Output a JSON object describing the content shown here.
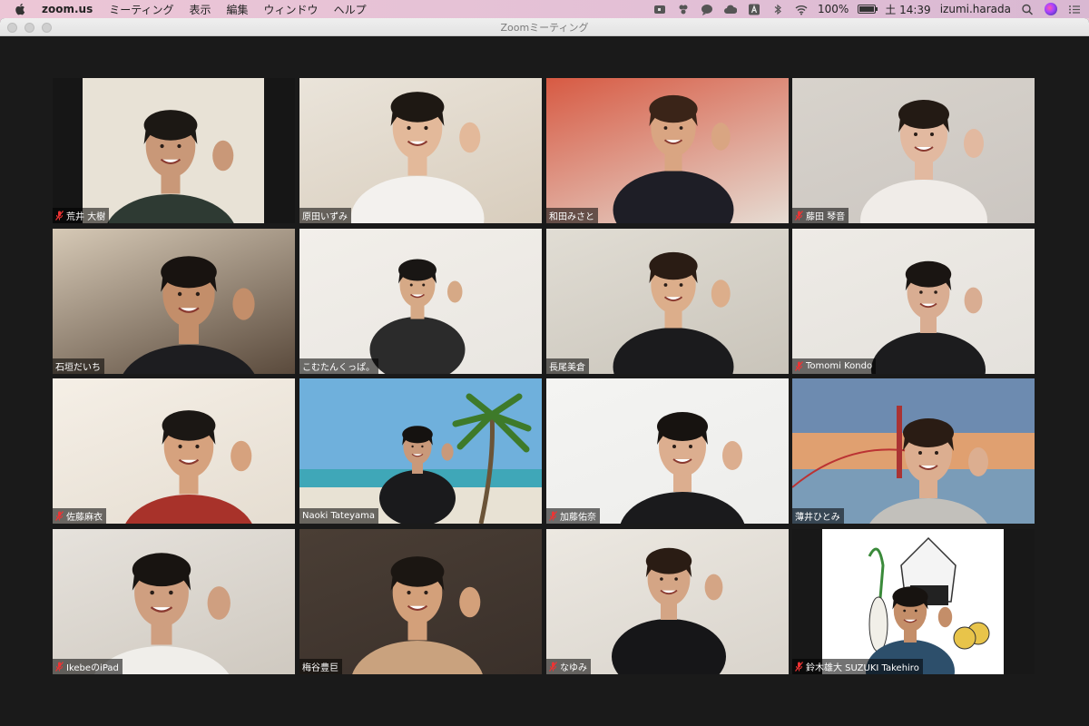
{
  "menubar": {
    "app_name": "zoom.us",
    "menus": [
      "ミーティング",
      "表示",
      "編集",
      "ウィンドウ",
      "ヘルプ"
    ],
    "battery_percent": "100%",
    "battery_level": 1.0,
    "clock": "土 14:39",
    "user": "izumi.harada"
  },
  "window": {
    "title": "Zoomミーティング"
  },
  "participants": [
    {
      "name": "荒井 大樹",
      "muted": true,
      "bg": "#3c3a36",
      "wall": "#e8e2d6",
      "shirt": "#2e3a33",
      "skin": "#c99878",
      "hair": "#1c1814"
    },
    {
      "name": "原田いずみ",
      "muted": false,
      "bg": "#d8cdbd",
      "wall": "#eae4da",
      "shirt": "#f3f1ee",
      "skin": "#e3b99a",
      "hair": "#1e1813"
    },
    {
      "name": "和田みさと",
      "muted": false,
      "bg": "#e6dcd3",
      "wall": "#d75a43",
      "shirt": "#1e1e26",
      "skin": "#d9a582",
      "hair": "#3a2418"
    },
    {
      "name": "藤田 琴音",
      "muted": true,
      "bg": "#cbc6c1",
      "wall": "#d8d3cc",
      "shirt": "#f0ece8",
      "skin": "#e2b9a0",
      "hair": "#231a14"
    },
    {
      "name": "石垣だいち",
      "muted": false,
      "bg": "#5a4a3c",
      "wall": "#d6c9b6",
      "shirt": "#1d1d20",
      "skin": "#c38e6a",
      "hair": "#181310"
    },
    {
      "name": "こむたんくっぱ。",
      "muted": false,
      "bg": "#e9e6e1",
      "wall": "#f2efea",
      "shirt": "#2b2b2b",
      "skin": "#d6a986",
      "hair": "#191614"
    },
    {
      "name": "長尾美倉",
      "muted": false,
      "bg": "#c9c4ba",
      "wall": "#e1ddd4",
      "shirt": "#1b1b1d",
      "skin": "#dcae8b",
      "hair": "#2a1c14"
    },
    {
      "name": "Tomomi Kondo",
      "muted": true,
      "bg": "#e4e1dc",
      "wall": "#eeebe6",
      "shirt": "#1c1c1e",
      "skin": "#d9ad92",
      "hair": "#1a1512"
    },
    {
      "name": "佐藤麻衣",
      "muted": true,
      "bg": "#e5ddd1",
      "wall": "#f5efe6",
      "shirt": "#a8322a",
      "skin": "#d6a27e",
      "hair": "#1b1714"
    },
    {
      "name": "Naoki Tateyama",
      "muted": false,
      "bg": "#6fa3cf",
      "wall": "#7db9e0",
      "shirt": "#1a1a1c",
      "skin": "#c9997a",
      "hair": "#151210"
    },
    {
      "name": "加藤佑奈",
      "muted": true,
      "bg": "#ededeb",
      "wall": "#f4f4f2",
      "shirt": "#1a1a1c",
      "skin": "#dcae8f",
      "hair": "#171310"
    },
    {
      "name": "薄井ひとみ",
      "muted": false,
      "bg": "#b9734d",
      "wall": "#6f8fab",
      "shirt": "#c2c0bb",
      "skin": "#dcae90",
      "hair": "#2a1c14"
    },
    {
      "name": "IkebeのiPad",
      "muted": true,
      "bg": "#cfc9c0",
      "wall": "#e6e2dc",
      "shirt": "#f0eeea",
      "skin": "#cf9f80",
      "hair": "#181411"
    },
    {
      "name": "梅谷豊巨",
      "muted": false,
      "bg": "#3a302a",
      "wall": "#4a3e35",
      "shirt": "#c9a27e",
      "skin": "#d3a07a",
      "hair": "#1b1612"
    },
    {
      "name": "なゆみ",
      "muted": true,
      "bg": "#d9d4cc",
      "wall": "#ece8e1",
      "shirt": "#161618",
      "skin": "#d4a585",
      "hair": "#2a1c14"
    },
    {
      "name": "鈴木雄大 SUZUKI Takehiro",
      "muted": true,
      "bg": "#ffffff",
      "wall": "#ffffff",
      "shirt": "#2d4f6b",
      "skin": "#c48e69",
      "hair": "#171310"
    }
  ]
}
